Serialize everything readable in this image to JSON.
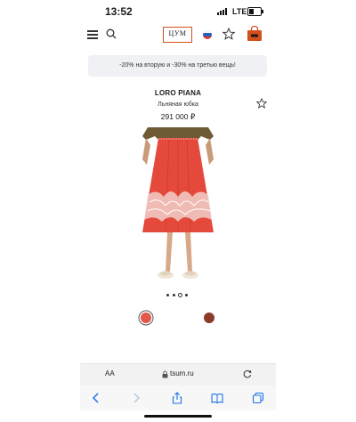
{
  "status_bar": {
    "time": "13:52",
    "network": "LTE"
  },
  "header": {
    "logo_text": "ЦУМ",
    "icons": [
      "menu-icon",
      "search-icon",
      "flag-icon",
      "star-icon",
      "bag-icon"
    ]
  },
  "promo": {
    "text": "-20% на вторую и -30% на третью вещь!"
  },
  "product": {
    "brand": "LORO PIANA",
    "name": "Льняная юбка",
    "price": "291 000 ₽"
  },
  "carousel": {
    "count": 4,
    "active_index": 2
  },
  "colors": [
    {
      "hex": "#e2584a",
      "selected": true
    },
    {
      "hex": "#8a3b2a",
      "selected": false
    }
  ],
  "browser": {
    "aa_label": "AA",
    "url": "tsum.ru",
    "toolbar_icons": [
      "back-icon",
      "forward-icon",
      "share-icon",
      "bookmarks-icon",
      "tabs-icon"
    ]
  },
  "theme": {
    "accent": "#d2501e",
    "link_blue": "#1a73e8",
    "skirt": "#e5493c"
  }
}
